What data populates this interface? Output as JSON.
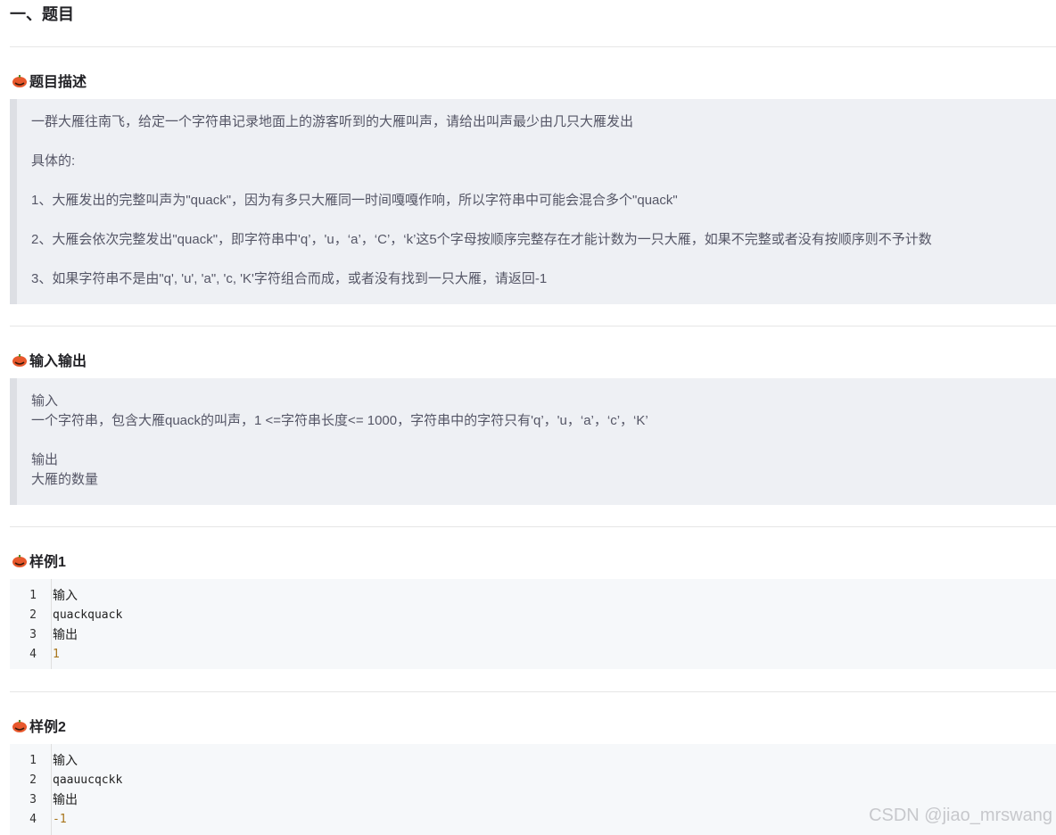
{
  "heading": "一、题目",
  "sections": {
    "description": {
      "title": "题目描述",
      "lines": [
        "一群大雁往南飞，给定一个字符串记录地面上的游客听到的大雁叫声，请给出叫声最少由几只大雁发出",
        "具体的:",
        "1、大雁发出的完整叫声为\"quack\"，因为有多只大雁同一时间嘎嘎作响，所以字符串中可能会混合多个\"quack\"",
        "2、大雁会依次完整发出\"quack\"，即字符串中'q’，'u，‘a’，‘C’，‘k’这5个字母按顺序完整存在才能计数为一只大雁，如果不完整或者没有按顺序则不予计数",
        "3、如果字符串不是由\"q', 'u', 'a\", 'c, 'K'字符组合而成，或者没有找到一只大雁，请返回-1"
      ]
    },
    "io": {
      "title": "输入输出",
      "lines": [
        "输入",
        "一个字符串，包含大雁quack的叫声，1 <=字符串长度<= 1000，字符串中的字符只有'q’，'u，‘a’，‘c’，‘K’",
        "输出",
        "大雁的数量"
      ]
    },
    "example1": {
      "title": "样例1",
      "code": [
        {
          "n": "1",
          "text": "输入"
        },
        {
          "n": "2",
          "text": "quackquack"
        },
        {
          "n": "3",
          "text": "输出"
        },
        {
          "n": "4",
          "text": "1"
        }
      ]
    },
    "example2": {
      "title": "样例2",
      "code": [
        {
          "n": "1",
          "text": "输入"
        },
        {
          "n": "2",
          "text": "qaauucqckk"
        },
        {
          "n": "3",
          "text": "输出"
        },
        {
          "n": "4",
          "text": "-1"
        }
      ]
    }
  },
  "watermark": "CSDN @jiao_mrswang",
  "colors": {
    "quote_bg": "#eef0f4",
    "quote_border": "#dddfe4",
    "code_bg": "#f6f8fa",
    "number": "#a8751b"
  }
}
